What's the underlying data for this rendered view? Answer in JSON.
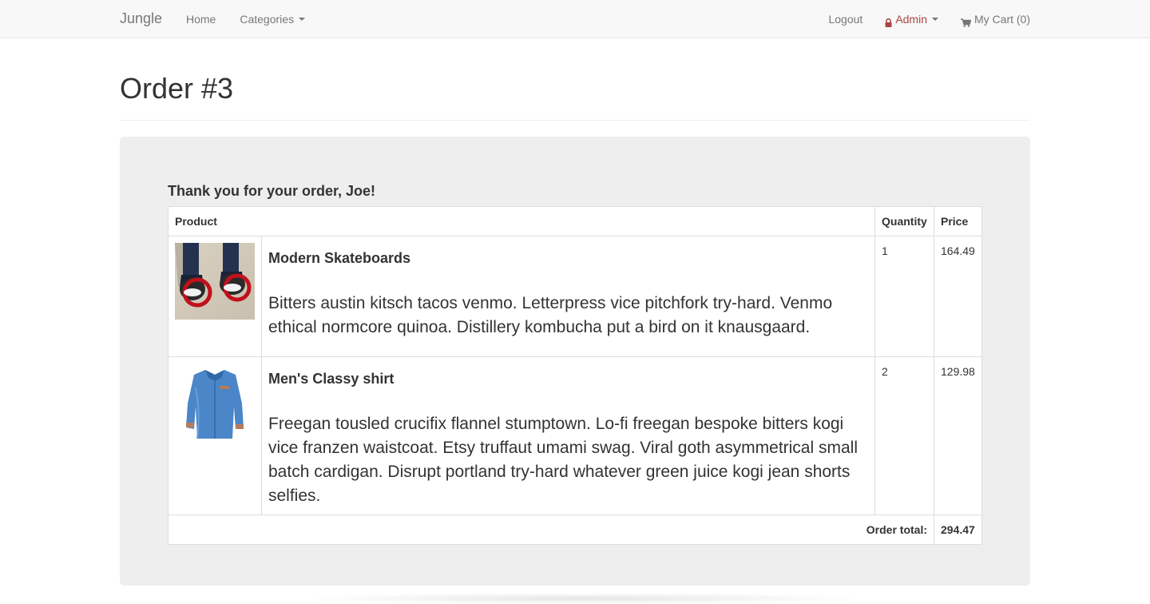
{
  "nav": {
    "brand": "Jungle",
    "home": "Home",
    "categories": "Categories",
    "logout": "Logout",
    "admin": "Admin",
    "cart": "My Cart (0)"
  },
  "colors": {
    "admin": "#a94442",
    "navbar_bg": "#f8f8f8",
    "well_bg": "#eeeeee"
  },
  "page": {
    "title": "Order #3"
  },
  "order": {
    "thanks": "Thank you for your order, Joe!",
    "headers": {
      "product": "Product",
      "quantity": "Quantity",
      "price": "Price"
    },
    "items": [
      {
        "name": "Modern Skateboards",
        "description": "Bitters austin kitsch tacos venmo. Letterpress vice pitchfork try-hard. Venmo ethical normcore quinoa. Distillery kombucha put a bird on it knausgaard.",
        "quantity": "1",
        "price": "164.49",
        "image_icon": "skate-shoes-photo"
      },
      {
        "name": "Men's Classy shirt",
        "description": "Freegan tousled crucifix flannel stumptown. Lo-fi freegan bespoke bitters kogi vice franzen waistcoat. Etsy truffaut umami swag. Viral goth asymmetrical small batch cardigan. Disrupt portland try-hard whatever green juice kogi jean shorts selfies.",
        "quantity": "2",
        "price": "129.98",
        "image_icon": "blue-shirt-photo"
      }
    ],
    "total_label": "Order total:",
    "total_value": "294.47"
  }
}
